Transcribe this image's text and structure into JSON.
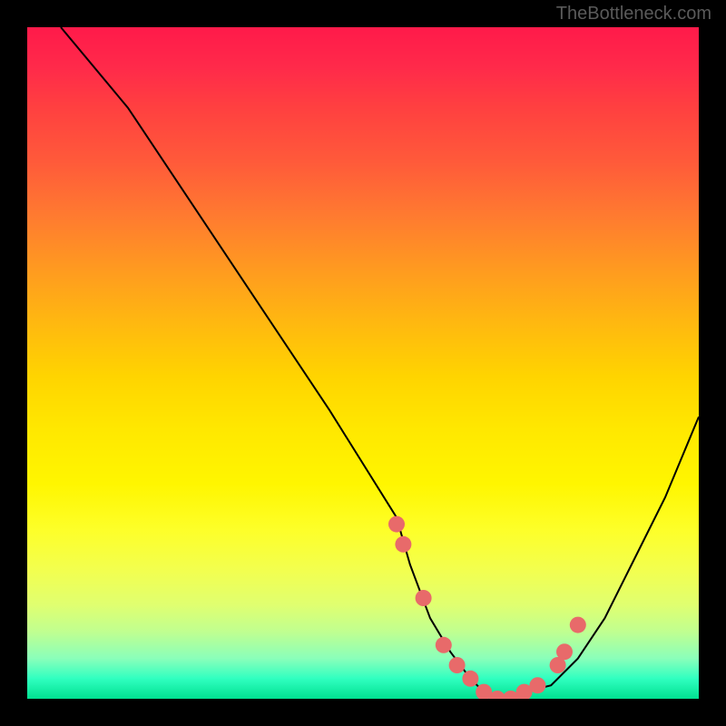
{
  "attribution": "TheBottleneck.com",
  "chart_data": {
    "type": "line",
    "title": "",
    "xlabel": "",
    "ylabel": "",
    "xlim": [
      0,
      100
    ],
    "ylim": [
      0,
      100
    ],
    "series": [
      {
        "name": "bottleneck-curve",
        "x": [
          5,
          15,
          25,
          35,
          45,
          55,
          57,
          60,
          63,
          66,
          68,
          70,
          72,
          74,
          78,
          82,
          86,
          90,
          95,
          100
        ],
        "y": [
          100,
          88,
          73,
          58,
          43,
          27,
          20,
          12,
          7,
          3,
          1,
          0,
          0,
          1,
          2,
          6,
          12,
          20,
          30,
          42
        ]
      }
    ],
    "markers": {
      "name": "highlight-points",
      "x": [
        55,
        56,
        59,
        62,
        64,
        66,
        68,
        70,
        72,
        74,
        76,
        79,
        80,
        82
      ],
      "y": [
        26,
        23,
        15,
        8,
        5,
        3,
        1,
        0,
        0,
        1,
        2,
        5,
        7,
        11
      ]
    },
    "gradient_stops": [
      {
        "pos": 0,
        "color": "#ff1a4a"
      },
      {
        "pos": 50,
        "color": "#ffd400"
      },
      {
        "pos": 90,
        "color": "#c0ff90"
      },
      {
        "pos": 100,
        "color": "#00e090"
      }
    ]
  }
}
